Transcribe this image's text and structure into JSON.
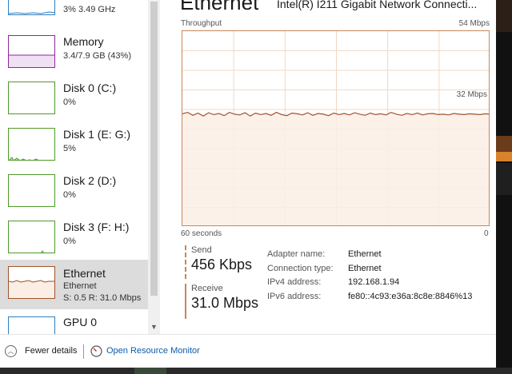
{
  "sidebar": {
    "cpu": {
      "sub": "3%  3.49 GHz"
    },
    "memory": {
      "title": "Memory",
      "sub": "3.4/7.9 GB (43%)"
    },
    "disk0": {
      "title": "Disk 0 (C:)",
      "sub": "0%"
    },
    "disk1": {
      "title": "Disk 1 (E: G:)",
      "sub": "5%"
    },
    "disk2": {
      "title": "Disk 2 (D:)",
      "sub": "0%"
    },
    "disk3": {
      "title": "Disk 3 (F: H:)",
      "sub": "0%"
    },
    "ethernet": {
      "title": "Ethernet",
      "sub1": "Ethernet",
      "sub2": "S: 0.5  R: 31.0 Mbps"
    },
    "gpu": {
      "title": "GPU 0"
    }
  },
  "main": {
    "title": "Ethernet",
    "adapter": "Intel(R) I211 Gigabit Network Connecti...",
    "throughput_label": "Throughput",
    "max_label": "54 Mbps",
    "mid_label": "32 Mbps",
    "time_label": "60 seconds",
    "zero_label": "0",
    "send_label": "Send",
    "send_value": "456 Kbps",
    "receive_label": "Receive",
    "receive_value": "31.0 Mbps",
    "info_keys": [
      "Adapter name:",
      "Connection type:",
      "IPv4 address:",
      "IPv6 address:"
    ],
    "info_values": [
      "Ethernet",
      "Ethernet",
      "192.168.1.94",
      "fe80::4c93:e36a:8c8e:8846%13"
    ]
  },
  "footer": {
    "fewer_details": "Fewer details",
    "resource_monitor": "Open Resource Monitor"
  },
  "colors": {
    "ethernet_line": "#a0522d",
    "ethernet_fill": "#fbeee4",
    "graph_border": "#c9865a",
    "memory_border": "#8b2a9b",
    "disk_border": "#4f9a2a",
    "cpu_border": "#2f7fc1",
    "link": "#0b5ca8"
  },
  "chart_data": {
    "type": "area",
    "title": "Throughput",
    "ylim": [
      0,
      54
    ],
    "y_unit": "Mbps",
    "x_label": "60 seconds",
    "series": [
      {
        "name": "Receive",
        "values": [
          31.2,
          31.6,
          30.8,
          31.4,
          30.6,
          31.5,
          31.0,
          31.3,
          30.7,
          31.6,
          31.1,
          30.9,
          31.5,
          30.6,
          31.4,
          31.0,
          31.3,
          30.8,
          31.6,
          31.0,
          30.7,
          31.4,
          31.2,
          30.9,
          31.5,
          30.8,
          31.3,
          31.1,
          30.7,
          31.4,
          31.0,
          31.3,
          30.9,
          31.5,
          31.1,
          30.8,
          31.4,
          31.0,
          31.2,
          30.9,
          31.6,
          31.1,
          30.8,
          31.3,
          31.0,
          31.4,
          30.9,
          31.2,
          31.3,
          31.0,
          31.1,
          30.9,
          31.3,
          31.1,
          31.0,
          31.2,
          31.1,
          31.0,
          31.2,
          31.1
        ]
      }
    ]
  }
}
